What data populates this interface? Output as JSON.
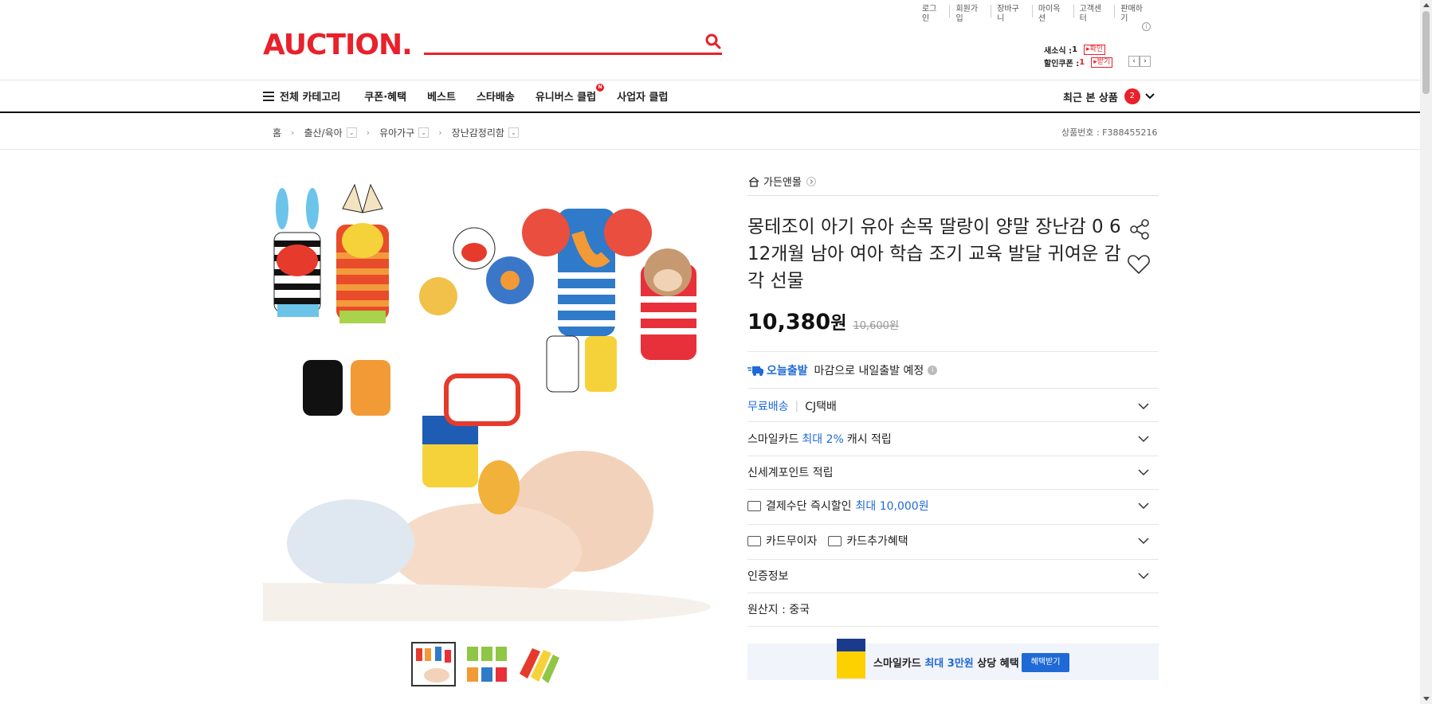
{
  "util_links": [
    "로그인",
    "회원가입",
    "장바구니",
    "마이옥션",
    "고객센터",
    "판매하기"
  ],
  "logo": "AUCTION.",
  "mini": {
    "saesosik_label": "새소식 :",
    "saesosik_count": "1",
    "saesosik_btn": "▸확인",
    "coupon_label": "할인쿠폰 :",
    "coupon_count": "1",
    "coupon_btn": "▸받기"
  },
  "nav": {
    "all_categories": "전체 카테고리",
    "items": [
      "쿠폰·혜택",
      "베스트",
      "스타배송",
      "유니버스 클럽",
      "사업자 클럽"
    ],
    "new_badge": "N",
    "recent_label": "최근 본 상품",
    "recent_count": "2"
  },
  "breadcrumb": {
    "home": "홈",
    "items": [
      "출산/육아",
      "유아가구",
      "장난감정리함"
    ]
  },
  "product_no": "상품번호 : F388455216",
  "store": "가든앤몰",
  "title": "몽테조이 아기 유아 손목 딸랑이 양말 장난감 0 6 12개월 남아 여아 학습 조기 교육 발달 귀여운 감각 선물",
  "price": {
    "main": "10,380",
    "unit": "원",
    "original": "10,600원"
  },
  "today": {
    "label": "오늘출발",
    "text": "마감으로 내일출발 예정"
  },
  "shipping": {
    "free": "무료배송",
    "courier": "CJ택배"
  },
  "smilecard": {
    "pre": "스마일카드",
    "highlight": "최대 2%",
    "post": "캐시 적립"
  },
  "shinsegae": "신세계포인트 적립",
  "payment": {
    "pre": "결제수단 즉시할인",
    "highlight": "최대 10,000원"
  },
  "card_interest": "카드무이자",
  "card_benefit": "카드추가혜택",
  "cert": "인증정보",
  "origin": "원산지 : 중국",
  "banner": {
    "pre": "스마일카드",
    "highlight": "최대 3만원",
    "post": "상당 혜택",
    "button": "혜택받기"
  }
}
